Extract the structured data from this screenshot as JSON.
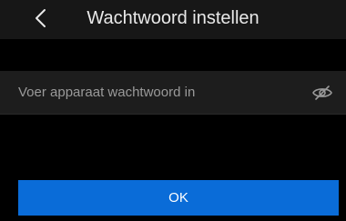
{
  "header": {
    "title": "Wachtwoord instellen",
    "back_icon": "chevron-left-icon"
  },
  "password_field": {
    "value": "",
    "placeholder": "Voer apparaat wachtwoord in",
    "visibility_icon": "eye-slash-icon"
  },
  "ok_button": {
    "label": "OK"
  },
  "colors": {
    "background": "#000000",
    "header_bg": "#171717",
    "field_bg": "#1d1d1d",
    "accent": "#0a6cd8",
    "text_primary": "#e9e9e9",
    "text_placeholder": "#9a9a9a"
  }
}
